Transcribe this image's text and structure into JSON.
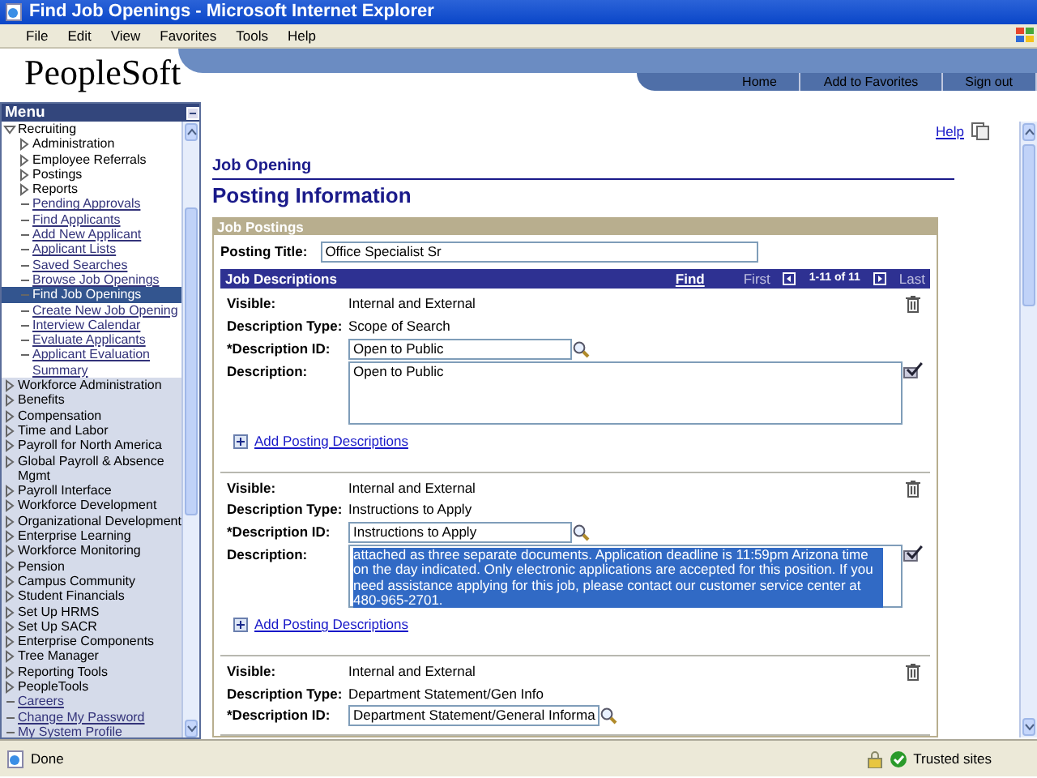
{
  "window": {
    "title": "Find Job Openings - Microsoft Internet Explorer"
  },
  "menu_bar": [
    "File",
    "Edit",
    "View",
    "Favorites",
    "Tools",
    "Help"
  ],
  "header": {
    "logo": "PeopleSoft",
    "links": [
      "Home",
      "Add to Favorites",
      "Sign out"
    ]
  },
  "menu": {
    "title": "Menu",
    "items": [
      {
        "label": "Recruiting",
        "kind": "folder",
        "expanded": true,
        "selected": false,
        "children": [
          {
            "label": "Administration",
            "kind": "folder",
            "expanded": false,
            "selected": false
          },
          {
            "label": "Employee Referrals",
            "kind": "folder",
            "expanded": false,
            "selected": false
          },
          {
            "label": "Postings",
            "kind": "folder",
            "expanded": false,
            "selected": false
          },
          {
            "label": "Reports",
            "kind": "folder",
            "expanded": false,
            "selected": false
          },
          {
            "label": "Pending Approvals",
            "kind": "link",
            "selected": false
          },
          {
            "label": "Find Applicants",
            "kind": "link",
            "selected": false
          },
          {
            "label": "Add New Applicant",
            "kind": "link",
            "selected": false
          },
          {
            "label": "Applicant Lists",
            "kind": "link",
            "selected": false
          },
          {
            "label": "Saved Searches",
            "kind": "link",
            "selected": false
          },
          {
            "label": "Browse Job Openings",
            "kind": "link",
            "selected": false
          },
          {
            "label": "Find Job Openings",
            "kind": "link",
            "selected": true
          },
          {
            "label": "Create New Job Opening",
            "kind": "link",
            "selected": false
          },
          {
            "label": "Interview Calendar",
            "kind": "link",
            "selected": false
          },
          {
            "label": "Evaluate Applicants",
            "kind": "link",
            "selected": false
          },
          {
            "label": "Applicant Evaluation Summary",
            "kind": "link",
            "selected": false
          }
        ]
      },
      {
        "label": "Workforce Administration",
        "kind": "folder",
        "expanded": false,
        "selected": false
      },
      {
        "label": "Benefits",
        "kind": "folder",
        "expanded": false,
        "selected": false
      },
      {
        "label": "Compensation",
        "kind": "folder",
        "expanded": false,
        "selected": false
      },
      {
        "label": "Time and Labor",
        "kind": "folder",
        "expanded": false,
        "selected": false
      },
      {
        "label": "Payroll for North America",
        "kind": "folder",
        "expanded": false,
        "selected": false
      },
      {
        "label": "Global Payroll & Absence Mgmt",
        "kind": "folder",
        "expanded": false,
        "selected": false
      },
      {
        "label": "Payroll Interface",
        "kind": "folder",
        "expanded": false,
        "selected": false
      },
      {
        "label": "Workforce Development",
        "kind": "folder",
        "expanded": false,
        "selected": false
      },
      {
        "label": "Organizational Development",
        "kind": "folder",
        "expanded": false,
        "selected": false
      },
      {
        "label": "Enterprise Learning",
        "kind": "folder",
        "expanded": false,
        "selected": false
      },
      {
        "label": "Workforce Monitoring",
        "kind": "folder",
        "expanded": false,
        "selected": false
      },
      {
        "label": "Pension",
        "kind": "folder",
        "expanded": false,
        "selected": false
      },
      {
        "label": "Campus Community",
        "kind": "folder",
        "expanded": false,
        "selected": false
      },
      {
        "label": "Student Financials",
        "kind": "folder",
        "expanded": false,
        "selected": false
      },
      {
        "label": "Set Up HRMS",
        "kind": "folder",
        "expanded": false,
        "selected": false
      },
      {
        "label": "Set Up SACR",
        "kind": "folder",
        "expanded": false,
        "selected": false
      },
      {
        "label": "Enterprise Components",
        "kind": "folder",
        "expanded": false,
        "selected": false
      },
      {
        "label": "Tree Manager",
        "kind": "folder",
        "expanded": false,
        "selected": false
      },
      {
        "label": "Reporting Tools",
        "kind": "folder",
        "expanded": false,
        "selected": false
      },
      {
        "label": "PeopleTools",
        "kind": "folder",
        "expanded": false,
        "selected": false
      },
      {
        "label": "Careers",
        "kind": "link",
        "selected": false
      },
      {
        "label": "Change My Password",
        "kind": "link",
        "selected": false
      },
      {
        "label": "My System Profile",
        "kind": "link",
        "selected": false
      }
    ]
  },
  "page": {
    "help_link": "Help",
    "breadcrumb": "Job Opening",
    "title": "Posting Information",
    "section": "Job Postings",
    "posting_title": {
      "label": "Posting Title:",
      "value": "Office Specialist Sr"
    },
    "grid": {
      "title": "Job Descriptions",
      "find": "Find",
      "first": "First",
      "range": "1-11 of 11",
      "last": "Last",
      "rows": [
        {
          "visible_label": "Visible:",
          "visible": "Internal and External",
          "type_label": "Description Type:",
          "type": "Scope of Search",
          "id_label": "*Description ID:",
          "id": "Open to Public",
          "description_label": "Description:",
          "description": "Open to Public",
          "description_selected": false,
          "add_link": "Add Posting Descriptions"
        },
        {
          "visible_label": "Visible:",
          "visible": "Internal and External",
          "type_label": "Description Type:",
          "type": "Instructions to Apply",
          "id_label": "*Description ID:",
          "id": "Instructions to Apply",
          "description_label": "Description:",
          "description": "attached as three separate documents. Application deadline is 11:59pm Arizona time on the day indicated. Only electronic applications are accepted for this position. If you need assistance applying for this job, please contact our customer service center at 480-965-2701.",
          "description_selected": true,
          "add_link": "Add Posting Descriptions"
        },
        {
          "visible_label": "Visible:",
          "visible": "Internal and External",
          "type_label": "Description Type:",
          "type": "Department Statement/Gen Info",
          "id_label": "*Description ID:",
          "id": "Department Statement/General Informa"
        }
      ]
    }
  },
  "status_bar": {
    "text": "Done",
    "zone": "Trusted sites"
  }
}
